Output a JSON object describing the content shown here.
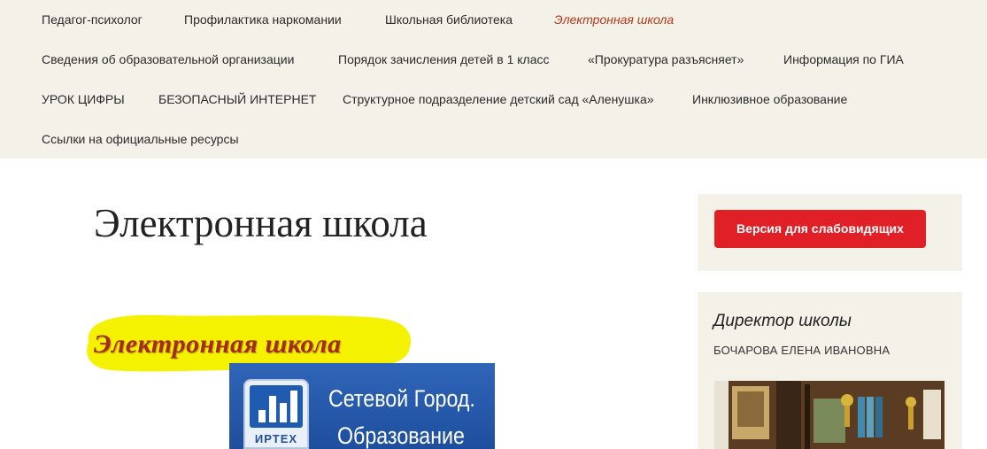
{
  "nav": {
    "items": [
      {
        "label": "Педагог-психолог",
        "active": false
      },
      {
        "label": "Профилактика наркомании",
        "active": false
      },
      {
        "label": "Школьная библиотека",
        "active": false
      },
      {
        "label": "Электронная школа",
        "active": true
      },
      {
        "label": "Сведения об образовательной организации",
        "active": false
      },
      {
        "label": "Порядок зачисления детей в 1 класс",
        "active": false
      },
      {
        "label": "«Прокуратура разъясняет»",
        "active": false
      },
      {
        "label": "Информация по ГИА",
        "active": false
      },
      {
        "label": "УРОК ЦИФРЫ",
        "active": false
      },
      {
        "label": "БЕЗОПАСНЫЙ ИНТЕРНЕТ",
        "active": false
      },
      {
        "label": "Структурное подразделение детский сад «Аленушка»",
        "active": false
      },
      {
        "label": "Инклюзивное образование",
        "active": false
      },
      {
        "label": "Ссылки на официальные ресурсы",
        "active": false
      }
    ]
  },
  "main": {
    "title": "Электронная школа",
    "highlight_title": "Электронная школа",
    "banner": {
      "logo_text": "ИРТЕХ",
      "line1": "Сетевой Город.",
      "line2": "Образование"
    }
  },
  "sidebar": {
    "vision_button": "Версия для слабовидящих",
    "director_title": "Директор школы",
    "director_name": "БОЧАРОВА ЕЛЕНА ИВАНОВНА"
  },
  "colors": {
    "nav_bg": "#f4f2e8",
    "active_link": "#b5371c",
    "button_red": "#e01f26",
    "highlight_yellow": "#f4f200",
    "banner_blue": "#2459ad"
  }
}
